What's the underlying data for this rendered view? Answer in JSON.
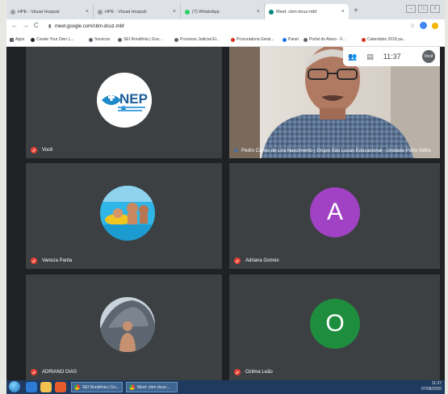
{
  "browser": {
    "tabs": [
      {
        "title": "HPE - Visual Hospub",
        "favicon_color": "#9aa0a6",
        "active": false
      },
      {
        "title": "HPE - Visual Hospub",
        "favicon_color": "#9aa0a6",
        "active": false
      },
      {
        "title": "(7) WhatsApp",
        "favicon_color": "#25d366",
        "active": false
      },
      {
        "title": "Meet: cbm-dcuz-mbf",
        "favicon_color": "#00897b",
        "active": true
      }
    ],
    "url": "meet.google.com/cbm-dcuz-mbf",
    "bookmarks": [
      {
        "label": "Apps",
        "icon_color": "#5f6368"
      },
      {
        "label": "Create Your Own L...",
        "icon_color": "#202124"
      },
      {
        "label": "Servicos",
        "icon_color": "#5f6368"
      },
      {
        "label": "SEI Rondônia | Gov...",
        "icon_color": "#5f6368"
      },
      {
        "label": "Processo Judicial El...",
        "icon_color": "#5f6368"
      },
      {
        "label": "Procuradoria Geral...",
        "icon_color": "#d93025"
      },
      {
        "label": "Panel",
        "icon_color": "#1a73e8"
      },
      {
        "label": "Portal do Aluno - F...",
        "icon_color": "#5f6368"
      },
      {
        "label": "Calendário 2018 pa...",
        "icon_color": "#d93025"
      }
    ]
  },
  "meet": {
    "clock": "11:37",
    "self_label": "Você",
    "participants": [
      {
        "name": "Você",
        "avatar_type": "logo",
        "logo_text": "NEP"
      },
      {
        "name": "Pedro Carlos de Lira Nascimento | Grupo São Lucas Educacional - Unidade Porto Velho",
        "avatar_type": "video",
        "speaking": true
      },
      {
        "name": "Vaneza Panta",
        "avatar_type": "photo"
      },
      {
        "name": "Adriana Gomes",
        "avatar_type": "letter",
        "letter": "A",
        "color": "#a142c4"
      },
      {
        "name": "ADRIANO DIAS",
        "avatar_type": "photo"
      },
      {
        "name": "Ozilma Leão",
        "avatar_type": "letter",
        "letter": "O",
        "color": "#1e8e3e"
      }
    ]
  },
  "taskbar": {
    "tasks": [
      {
        "label": "SEI Rondônia | Go..."
      },
      {
        "label": "Meet: cbm-dcuz-..."
      }
    ],
    "time": "11:37",
    "date": "07/08/2020"
  }
}
